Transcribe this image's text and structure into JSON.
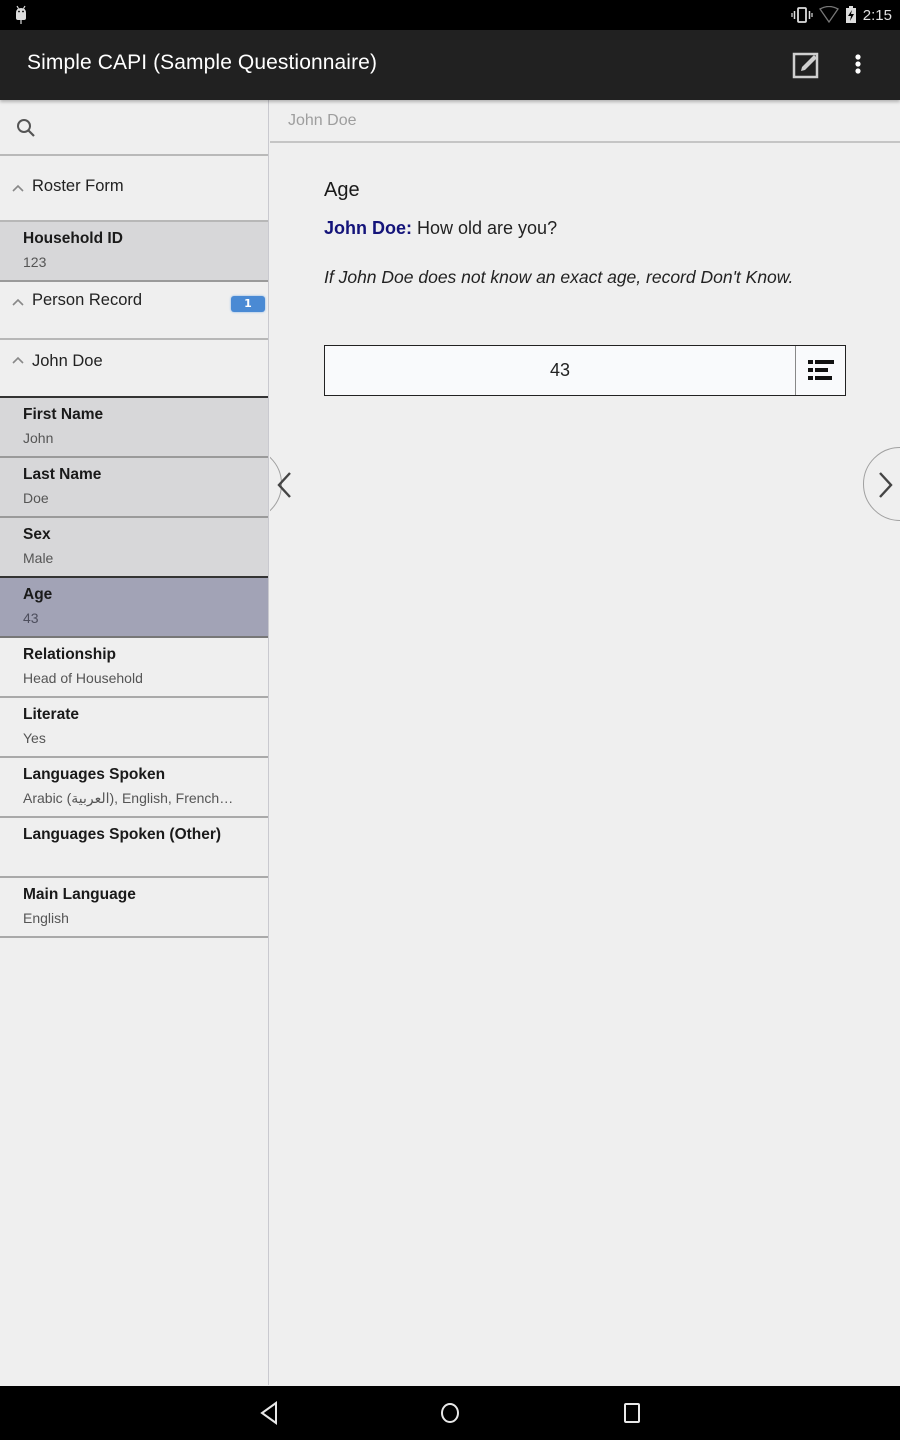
{
  "status_bar": {
    "time": "2:15",
    "icons": [
      "android-debug-icon",
      "vibrate-icon",
      "wifi-icon",
      "battery-charging-icon"
    ]
  },
  "app_bar": {
    "title": "Simple CAPI (Sample Questionnaire)",
    "actions": [
      "edit-icon",
      "overflow-menu-icon"
    ]
  },
  "sidebar": {
    "search": {
      "placeholder": "",
      "value": ""
    },
    "groups": [
      {
        "label": "Roster Form",
        "icon": "chevron-up-icon"
      },
      {
        "label": "Person Record",
        "icon": "chevron-up-icon",
        "badge": "1"
      },
      {
        "label": "John Doe",
        "icon": "chevron-up-icon"
      }
    ],
    "household_field": {
      "label": "Household ID",
      "value": "123"
    },
    "fields": [
      {
        "label": "First Name",
        "value": "John",
        "state": "filled"
      },
      {
        "label": "Last Name",
        "value": "Doe",
        "state": "filled"
      },
      {
        "label": "Sex",
        "value": "Male",
        "state": "filled"
      },
      {
        "label": "Age",
        "value": "43",
        "state": "current"
      },
      {
        "label": "Relationship",
        "value": "Head of Household",
        "state": "plain"
      },
      {
        "label": "Literate",
        "value": "Yes",
        "state": "plain"
      },
      {
        "label": "Languages Spoken",
        "value": "Arabic (العربية), English, French…",
        "state": "plain"
      },
      {
        "label": "Languages Spoken (Other)",
        "value": "",
        "state": "plain"
      },
      {
        "label": "Main Language",
        "value": "English",
        "state": "plain"
      }
    ]
  },
  "main": {
    "breadcrumb": "John Doe",
    "question": {
      "title": "Age",
      "respondent": "John Doe:",
      "text": " How old are you?",
      "help": "If John Doe does not know an exact age, record Don't Know.",
      "answer_value": "43"
    },
    "nav": {
      "prev": "chevron-left-icon",
      "next": "chevron-right-icon"
    }
  },
  "colors": {
    "app_bar": "#212121",
    "badge": "#4a8ad4",
    "current_field": "#a2a3b6",
    "filled_field": "#d7d7d9",
    "respondent_name": "#14147a"
  }
}
